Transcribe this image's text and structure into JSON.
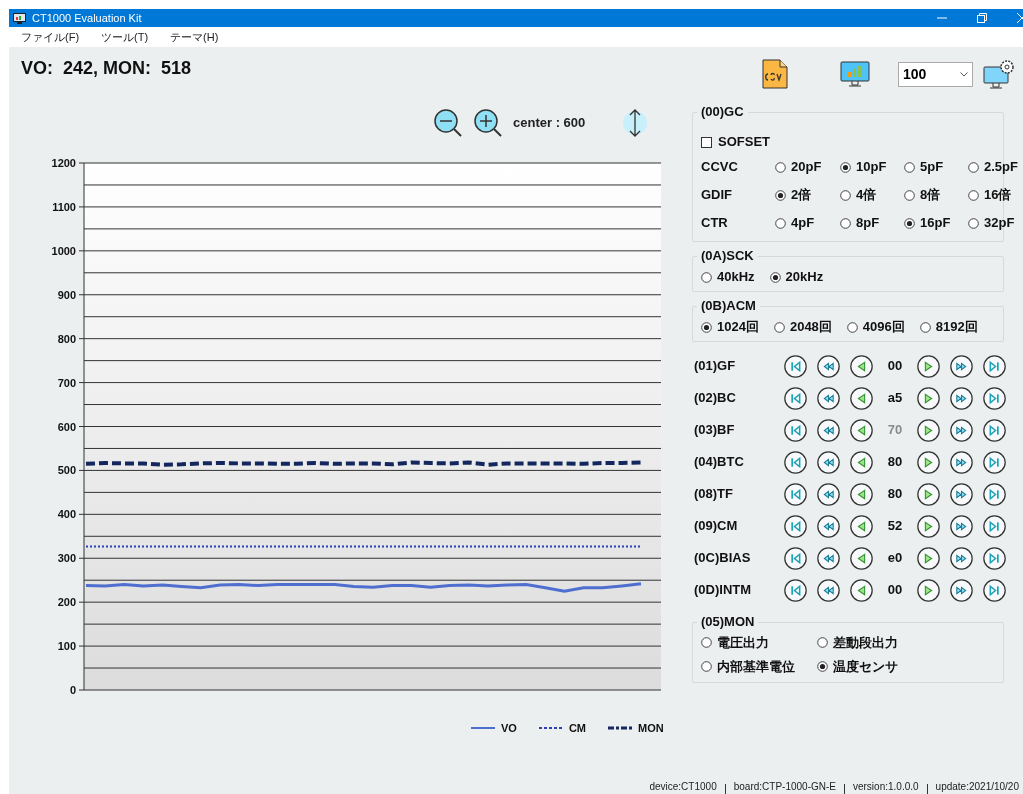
{
  "window": {
    "title": "CT1000 Evaluation Kit"
  },
  "menu": [
    "ファイル(F)",
    "ツール(T)",
    "テーマ(H)"
  ],
  "readout": "VO:  242, MON:  518",
  "toolbar": {
    "select_value": "100"
  },
  "zoom": {
    "center_label": "center : 600"
  },
  "chart_data": {
    "type": "line",
    "grid": true,
    "ylim": [
      0,
      1200
    ],
    "yticks": [
      0,
      100,
      200,
      300,
      400,
      500,
      600,
      700,
      800,
      900,
      1000,
      1100,
      1200
    ],
    "series": [
      {
        "name": "VO",
        "color": "#4f6fd0",
        "line_style": "solid",
        "values": [
          238,
          237,
          240,
          237,
          239,
          236,
          233,
          239,
          240,
          238,
          240,
          240,
          240,
          240,
          236,
          234,
          238,
          238,
          234,
          238,
          239,
          237,
          239,
          240,
          233,
          225,
          233,
          233,
          237,
          242
        ]
      },
      {
        "name": "CM",
        "color": "#2a3fb8",
        "line_style": "dotted",
        "values": [
          327,
          327,
          327,
          327,
          327,
          327,
          327,
          327,
          327,
          327,
          327,
          327,
          327,
          327,
          327,
          327,
          327,
          327,
          327,
          327,
          327,
          327,
          327,
          327,
          327,
          327,
          327,
          327,
          327,
          327
        ]
      },
      {
        "name": "MON",
        "color": "#13275e",
        "line_style": "dashed",
        "values": [
          515,
          517,
          516,
          516,
          513,
          514,
          516,
          517,
          516,
          516,
          515,
          515,
          517,
          515,
          516,
          516,
          514,
          518,
          517,
          516,
          518,
          513,
          516,
          516,
          516,
          516,
          515,
          517,
          517,
          518
        ]
      }
    ]
  },
  "groups": [
    {
      "title": "(00)GC",
      "checkbox": {
        "label": "SOFSET",
        "checked": false
      },
      "rows": [
        {
          "label": "CCVC",
          "options": [
            {
              "label": "20pF",
              "selected": false
            },
            {
              "label": "10pF",
              "selected": true
            },
            {
              "label": "5pF",
              "selected": false
            },
            {
              "label": "2.5pF",
              "selected": false
            }
          ]
        },
        {
          "label": "GDIF",
          "options": [
            {
              "label": "2倍",
              "selected": true
            },
            {
              "label": "4倍",
              "selected": false
            },
            {
              "label": "8倍",
              "selected": false
            },
            {
              "label": "16倍",
              "selected": false
            }
          ]
        },
        {
          "label": "CTR",
          "options": [
            {
              "label": "4pF",
              "selected": false
            },
            {
              "label": "8pF",
              "selected": false
            },
            {
              "label": "16pF",
              "selected": true
            },
            {
              "label": "32pF",
              "selected": false
            }
          ]
        }
      ]
    },
    {
      "title": "(0A)SCK",
      "rows": [
        {
          "options": [
            {
              "label": "40kHz",
              "selected": false
            },
            {
              "label": "20kHz",
              "selected": true
            }
          ]
        }
      ]
    },
    {
      "title": "(0B)ACM",
      "rows": [
        {
          "options": [
            {
              "label": "1024回",
              "selected": true
            },
            {
              "label": "2048回",
              "selected": false
            },
            {
              "label": "4096回",
              "selected": false
            },
            {
              "label": "8192回",
              "selected": false
            }
          ]
        }
      ]
    }
  ],
  "registers": [
    {
      "label": "(01)GF",
      "value": "00",
      "disabled": false
    },
    {
      "label": "(02)BC",
      "value": "a5",
      "disabled": false
    },
    {
      "label": "(03)BF",
      "value": "70",
      "disabled": true
    },
    {
      "label": "(04)BTC",
      "value": "80",
      "disabled": false
    },
    {
      "label": "(08)TF",
      "value": "80",
      "disabled": false
    },
    {
      "label": "(09)CM",
      "value": "52",
      "disabled": false
    },
    {
      "label": "(0C)BIAS",
      "value": "e0",
      "disabled": false
    },
    {
      "label": "(0D)INTM",
      "value": "00",
      "disabled": false
    }
  ],
  "mon": {
    "title": "(05)MON",
    "options": [
      {
        "label": "電圧出力",
        "selected": false
      },
      {
        "label": "差動段出力",
        "selected": false
      },
      {
        "label": "内部基準電位",
        "selected": false
      },
      {
        "label": "温度センサ",
        "selected": true
      }
    ]
  },
  "status_bar": [
    "device:CT1000",
    "board:CTP-1000-GN-E",
    "version:1.0.0.0",
    "update:2021/10/20"
  ]
}
